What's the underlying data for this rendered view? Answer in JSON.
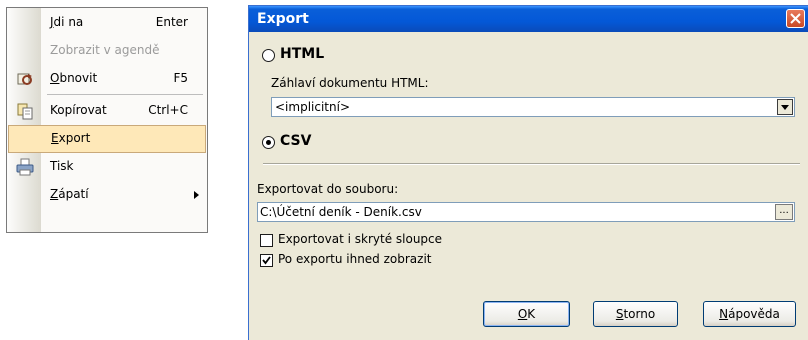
{
  "menu": {
    "items": [
      {
        "label": "Jdi na",
        "mn": "J",
        "shortcut": "Enter",
        "disabled": false,
        "icon": ""
      },
      {
        "label": "Zobrazit v agendě",
        "mn": "",
        "shortcut": "",
        "disabled": true,
        "icon": ""
      },
      {
        "label": "Obnovit",
        "mn": "O",
        "shortcut": "F5",
        "disabled": false,
        "icon": "refresh-icon"
      },
      {
        "label": "Kopírovat",
        "mn": "",
        "shortcut": "Ctrl+C",
        "disabled": false,
        "icon": "copy-icon"
      },
      {
        "label": "Export",
        "mn": "E",
        "shortcut": "",
        "disabled": false,
        "icon": ""
      },
      {
        "label": "Tisk",
        "mn": "",
        "shortcut": "",
        "disabled": false,
        "icon": "printer-icon"
      },
      {
        "label": "Zápatí",
        "mn": "Z",
        "shortcut": "",
        "disabled": false,
        "icon": ""
      }
    ]
  },
  "dialog": {
    "title": "Export",
    "html_option": "HTML",
    "header_label": "Záhlaví dokumentu HTML:",
    "header_value": "<implicitní>",
    "csv_option": "CSV",
    "export_to_label": "Exportovat do souboru:",
    "file_path": "C:\\Účetní deník - Deník.csv",
    "browse_label": "...",
    "export_hidden_label": "Exportovat i skryté sloupce",
    "export_hidden_checked": false,
    "show_after_label": "Po exportu ihned zobrazit",
    "show_after_checked": true,
    "buttons": {
      "ok": {
        "label": "OK",
        "mn": "O"
      },
      "cancel": {
        "label": "Storno",
        "mn": "S"
      },
      "help": {
        "label": "Nápověda",
        "mn": "N"
      }
    }
  }
}
